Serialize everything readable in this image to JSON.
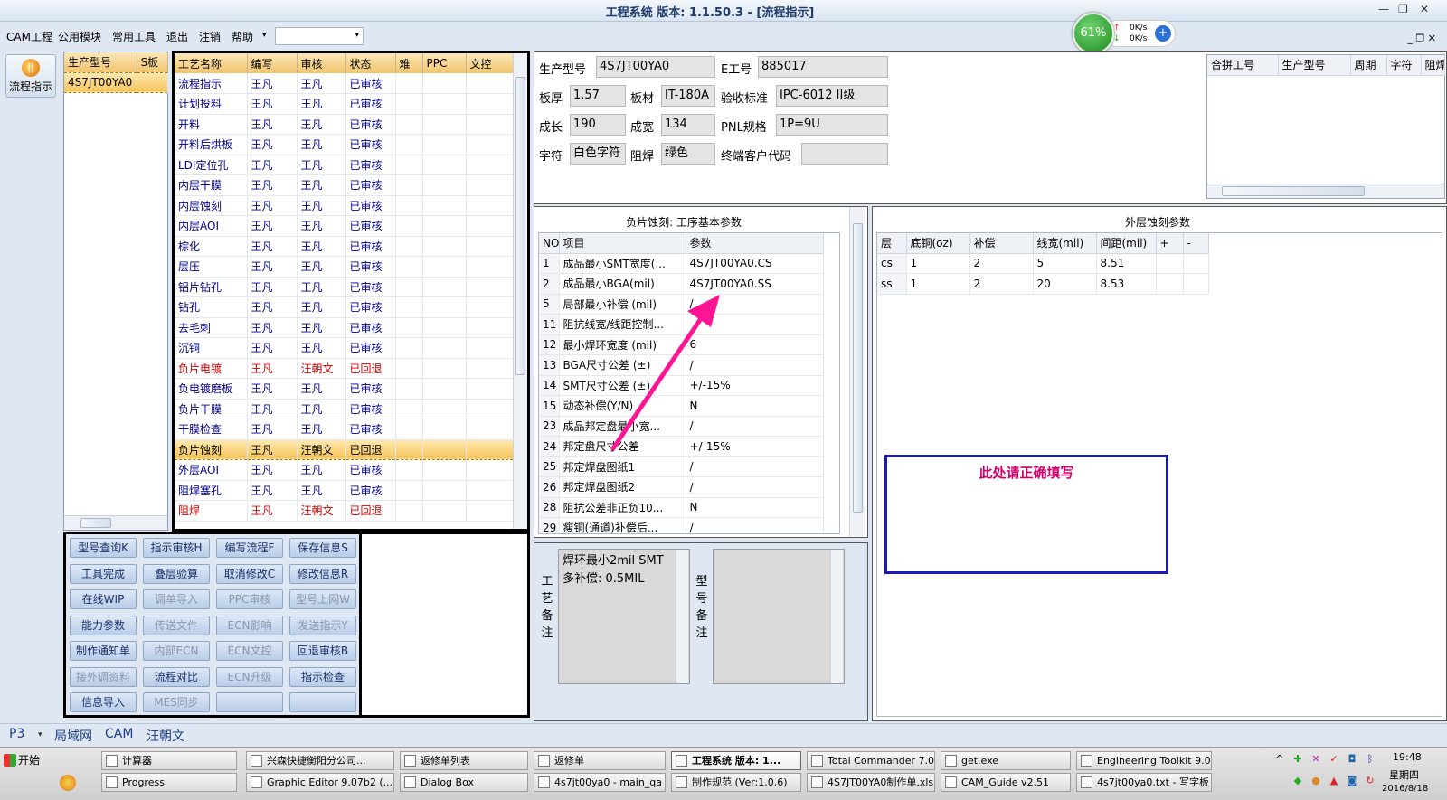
{
  "window": {
    "title": "工程系统  版本: 1.1.50.3 - [流程指示]",
    "minimize": "—",
    "restore": "❐",
    "close": "✕"
  },
  "menu": [
    "CAM工程",
    "公用模块",
    "常用工具",
    "退出",
    "注销",
    "帮助"
  ],
  "menu_dropdown_arrow": "▾",
  "network": {
    "percent": "61%",
    "up": "0K/s",
    "down": "0K/s",
    "up_arrow": "↑",
    "down_arrow": "↓",
    "plus": "+"
  },
  "mdi_buttons": "_ ❐ ✕",
  "sidebar": {
    "icon_glyph": "||",
    "label": "流程指示"
  },
  "model_list": {
    "headers": [
      "生产型号",
      "S板"
    ],
    "rows": [
      "4S7JT00YA0"
    ]
  },
  "process_table": {
    "headers": [
      "工艺名称",
      "编写",
      "审核",
      "状态",
      "难",
      "PPC",
      "文控"
    ],
    "rows": [
      {
        "name": "流程指示",
        "writer": "王凡",
        "reviewer": "王凡",
        "status": "已审核",
        "red": false,
        "sel": false
      },
      {
        "name": "计划投料",
        "writer": "王凡",
        "reviewer": "王凡",
        "status": "已审核",
        "red": false,
        "sel": false
      },
      {
        "name": "开料",
        "writer": "王凡",
        "reviewer": "王凡",
        "status": "已审核",
        "red": false,
        "sel": false
      },
      {
        "name": "开料后烘板",
        "writer": "王凡",
        "reviewer": "王凡",
        "status": "已审核",
        "red": false,
        "sel": false
      },
      {
        "name": "LDI定位孔",
        "writer": "王凡",
        "reviewer": "王凡",
        "status": "已审核",
        "red": false,
        "sel": false
      },
      {
        "name": "内层干膜",
        "writer": "王凡",
        "reviewer": "王凡",
        "status": "已审核",
        "red": false,
        "sel": false
      },
      {
        "name": "内层蚀刻",
        "writer": "王凡",
        "reviewer": "王凡",
        "status": "已审核",
        "red": false,
        "sel": false
      },
      {
        "name": "内层AOI",
        "writer": "王凡",
        "reviewer": "王凡",
        "status": "已审核",
        "red": false,
        "sel": false
      },
      {
        "name": "棕化",
        "writer": "王凡",
        "reviewer": "王凡",
        "status": "已审核",
        "red": false,
        "sel": false
      },
      {
        "name": "层压",
        "writer": "王凡",
        "reviewer": "王凡",
        "status": "已审核",
        "red": false,
        "sel": false
      },
      {
        "name": "铝片钻孔",
        "writer": "王凡",
        "reviewer": "王凡",
        "status": "已审核",
        "red": false,
        "sel": false
      },
      {
        "name": "钻孔",
        "writer": "王凡",
        "reviewer": "王凡",
        "status": "已审核",
        "red": false,
        "sel": false
      },
      {
        "name": "去毛刺",
        "writer": "王凡",
        "reviewer": "王凡",
        "status": "已审核",
        "red": false,
        "sel": false
      },
      {
        "name": "沉铜",
        "writer": "王凡",
        "reviewer": "王凡",
        "status": "已审核",
        "red": false,
        "sel": false
      },
      {
        "name": "负片电镀",
        "writer": "王凡",
        "reviewer": "汪朝文",
        "status": "已回退",
        "red": true,
        "sel": false
      },
      {
        "name": "负电镀磨板",
        "writer": "王凡",
        "reviewer": "王凡",
        "status": "已审核",
        "red": false,
        "sel": false
      },
      {
        "name": "负片干膜",
        "writer": "王凡",
        "reviewer": "王凡",
        "status": "已审核",
        "red": false,
        "sel": false
      },
      {
        "name": "干膜检查",
        "writer": "王凡",
        "reviewer": "王凡",
        "status": "已审核",
        "red": false,
        "sel": false
      },
      {
        "name": "负片蚀刻",
        "writer": "王凡",
        "reviewer": "汪朝文",
        "status": "已回退",
        "red": false,
        "sel": true
      },
      {
        "name": "外层AOI",
        "writer": "王凡",
        "reviewer": "王凡",
        "status": "已审核",
        "red": false,
        "sel": false
      },
      {
        "name": "阻焊塞孔",
        "writer": "王凡",
        "reviewer": "王凡",
        "status": "已审核",
        "red": false,
        "sel": false
      },
      {
        "name": "阻焊",
        "writer": "王凡",
        "reviewer": "汪朝文",
        "status": "已回退",
        "red": true,
        "sel": false
      }
    ]
  },
  "buttons": [
    {
      "label": "型号查询K",
      "enabled": true
    },
    {
      "label": "指示审核H",
      "enabled": true
    },
    {
      "label": "编写流程F",
      "enabled": true
    },
    {
      "label": "保存信息S",
      "enabled": true
    },
    {
      "label": "工具完成",
      "enabled": true
    },
    {
      "label": "叠层验算",
      "enabled": true
    },
    {
      "label": "取消修改C",
      "enabled": true
    },
    {
      "label": "修改信息R",
      "enabled": true
    },
    {
      "label": "在线WIP",
      "enabled": true
    },
    {
      "label": "调单导入",
      "enabled": false
    },
    {
      "label": "PPC审核",
      "enabled": false
    },
    {
      "label": "型号上网W",
      "enabled": false
    },
    {
      "label": "能力参数",
      "enabled": true
    },
    {
      "label": "传送文件",
      "enabled": false
    },
    {
      "label": "ECN影响",
      "enabled": false
    },
    {
      "label": "发送指示Y",
      "enabled": false
    },
    {
      "label": "制作通知单",
      "enabled": true
    },
    {
      "label": "内部ECN",
      "enabled": false
    },
    {
      "label": "ECN文控",
      "enabled": false
    },
    {
      "label": "回退审核B",
      "enabled": true
    },
    {
      "label": "接外调资料",
      "enabled": false
    },
    {
      "label": "流程对比",
      "enabled": true
    },
    {
      "label": "ECN升级",
      "enabled": false
    },
    {
      "label": "指示检查",
      "enabled": true
    },
    {
      "label": "信息导入",
      "enabled": true
    },
    {
      "label": "MES同步",
      "enabled": false
    },
    {
      "label": "",
      "enabled": true
    },
    {
      "label": "",
      "enabled": true
    }
  ],
  "info": {
    "model_label": "生产型号",
    "model": "4S7JT00YA0",
    "eno_label": "E工号",
    "eno": "885017",
    "thickness_label": "板厚",
    "thickness": "1.57",
    "material_label": "板材",
    "material": "IT-180A",
    "standard_label": "验收标准",
    "standard": "IPC-6012 II级",
    "length_label": "成长",
    "length": "190",
    "width_label": "成宽",
    "width": "134",
    "pnl_label": "PNL规格",
    "pnl": "1P=9U",
    "legend_label": "字符",
    "legend": "白色字符",
    "mask_label": "阻焊",
    "mask": "绿色",
    "customer_label": "终端客户代码",
    "customer": ""
  },
  "merge_table": {
    "headers": [
      "合拼工号",
      "生产型号",
      "周期",
      "字符",
      "阻焊"
    ]
  },
  "params": {
    "title": "负片蚀刻: 工序基本参数",
    "headers": [
      "NO",
      "项目",
      "参数"
    ],
    "rows": [
      {
        "no": "1",
        "item": "成品最小SMT宽度(...",
        "value": "4S7JT00YA0.CS"
      },
      {
        "no": "2",
        "item": "成品最小BGA(mil)",
        "value": "4S7JT00YA0.SS"
      },
      {
        "no": "5",
        "item": "局部最小补偿 (mil)",
        "value": "/"
      },
      {
        "no": "11",
        "item": "阻抗线宽/线距控制...",
        "value": ""
      },
      {
        "no": "12",
        "item": "最小焊环宽度 (mil)",
        "value": "6"
      },
      {
        "no": "13",
        "item": "BGA尺寸公差 (±)",
        "value": "/"
      },
      {
        "no": "14",
        "item": "SMT尺寸公差 (±)",
        "value": "+/-15%"
      },
      {
        "no": "15",
        "item": "动态补偿(Y/N)",
        "value": "N"
      },
      {
        "no": "23",
        "item": "成品邦定盘最小宽...",
        "value": "/"
      },
      {
        "no": "24",
        "item": "邦定盘尺寸公差",
        "value": "+/-15%"
      },
      {
        "no": "25",
        "item": "邦定焊盘图纸1",
        "value": "/"
      },
      {
        "no": "26",
        "item": "邦定焊盘图纸2",
        "value": "/"
      },
      {
        "no": "28",
        "item": "阻抗公差非正负10...",
        "value": "N"
      },
      {
        "no": "29",
        "item": "瘦铜(通道)补偿后...",
        "value": "/"
      }
    ]
  },
  "outer": {
    "title": "外层蚀刻参数",
    "headers": [
      "层",
      "底铜(oz)",
      "补偿",
      "线宽(mil)",
      "间距(mil)",
      "+",
      "-"
    ],
    "rows": [
      [
        "cs",
        "1",
        "2",
        "5",
        "8.51",
        "",
        ""
      ],
      [
        "ss",
        "1",
        "2",
        "20",
        "8.53",
        "",
        ""
      ]
    ]
  },
  "annotation": {
    "text": "此处请正确填写"
  },
  "process_remark": {
    "label": "工艺备注",
    "text": [
      "焊环最小2mil SMT",
      "多补偿: 0.5MIL"
    ]
  },
  "model_remark": {
    "label": "型号备注",
    "text": ""
  },
  "status": [
    "P3",
    "局域网",
    "CAM",
    "汪朝文"
  ],
  "taskbar": {
    "start": "开始",
    "row1": [
      "计算器",
      "兴森快捷衡阳分公司...",
      "返修单列表",
      "返修单",
      "工程系统  版本: 1...",
      "Total Commander 7.0 ...",
      "get.exe",
      "Engineering Toolkit 9.0..."
    ],
    "row2": [
      "Progress",
      "Graphic Editor 9.07b2 (...",
      "Dialog Box",
      "4s7jt00ya0 - main_qa",
      "制作规范 (Ver:1.0.6)",
      "4S7JT00YA0制作单.xls...",
      "CAM_Guide v2.51",
      "4s7jt00ya0.txt - 写字板"
    ],
    "time": "19:48",
    "weekday": "星期四",
    "date": "2016/8/18"
  },
  "colors": {
    "accent_red": "#d20000",
    "arrow_magenta": "#ff1493",
    "annotation_border": "#1a1ab8",
    "panel_border": "#000000"
  }
}
